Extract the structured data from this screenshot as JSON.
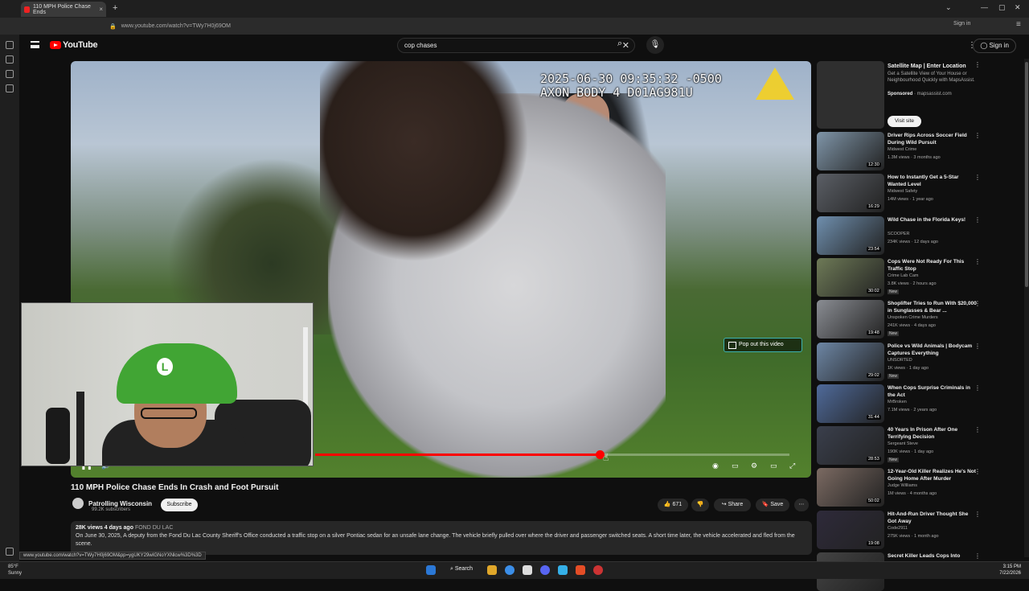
{
  "browser": {
    "tab_title": "110 MPH Police Chase Ends",
    "url": "www.youtube.com/watch?v=TWy7H0j69OM",
    "signin_label": "Sign in",
    "status_url": "www.youtube.com/watch?v=TWy7H0j69OM&pp=ygUKY29wIGNoYXNlcw%3D%3D"
  },
  "youtube": {
    "logo_text": "YouTube",
    "search_value": "cop chases",
    "signin_label": "Sign in"
  },
  "player": {
    "timestamp_line1": "2025-06-30 09:35:32 -0500",
    "timestamp_line2": "AXON BODY 4 D01AG981U",
    "popout_label": "Pop out this video",
    "time_display": "10:59 / 13:20",
    "progress_fraction": 0.6,
    "accent_color": "#ff0000"
  },
  "video": {
    "title": "110 MPH Police Chase Ends In Crash and Foot Pursuit",
    "channel": "Patrolling Wisconsin",
    "subscribers": "99.2K subscribers",
    "subscribe_label": "Subscribe",
    "likes": "671",
    "share_label": "Share",
    "save_label": "Save",
    "views_date": "28K views  4 days ago",
    "location_tag": "FOND DU LAC",
    "description": "On June 30, 2025, A deputy from the Fond Du Lac County Sheriff's Office conducted a traffic stop on a silver Pontiac sedan for an unsafe lane change. The vehicle briefly pulled over where the driver and passenger switched seats. A short time later, the vehicle accelerated and fled from the scene."
  },
  "ad": {
    "title": "Satellite Map | Enter Location",
    "desc": "Get a Satellite View of Your House or Neighbourhood Quickly with MapsAssist.",
    "sponsored": "Sponsored",
    "domain": "· mapsassist.com",
    "visit_label": "Visit site"
  },
  "related": [
    {
      "title": "Driver Rips Across Soccer Field During Wild Pursuit",
      "channel": "Midwest Crime",
      "meta": "1.3M views · 3 months ago",
      "duration": "12:30",
      "new": "",
      "color": "#7f95a8"
    },
    {
      "title": "How to Instantly Get a 5-Star Wanted Level",
      "channel": "Midwest Safety",
      "meta": "14M views · 1 year ago",
      "duration": "16:29",
      "new": "",
      "color": "#5b5f66"
    },
    {
      "title": "Wild Chase in the Florida Keys!",
      "channel": "SCOOPER",
      "meta": "234K views · 12 days ago",
      "duration": "23:54",
      "new": "",
      "color": "#6f8fae"
    },
    {
      "title": "Cops Were Not Ready For This Traffic Stop",
      "channel": "Crime Lab Cam",
      "meta": "3.8K views · 2 hours ago",
      "duration": "30:02",
      "new": "New",
      "color": "#6e7a57"
    },
    {
      "title": "Shoplifter Tries to Run With $20,000 in Sunglasses & Bear ...",
      "channel": "Unspoken Crime Murders",
      "meta": "241K views · 4 days ago",
      "duration": "19:48",
      "new": "New",
      "color": "#8a8d93"
    },
    {
      "title": "Police vs Wild Animals | Bodycam Captures Everything",
      "channel": "UNSORTED",
      "meta": "1K views · 1 day ago",
      "duration": "29:02",
      "new": "New",
      "color": "#6d86a5"
    },
    {
      "title": "When Cops Surprise Criminals in the Act",
      "channel": "MrBroken",
      "meta": "7.1M views · 2 years ago",
      "duration": "31:44",
      "new": "",
      "color": "#4f6a9a"
    },
    {
      "title": "40 Years In Prison After One Terrifying Decision",
      "channel": "Sergeant Steve",
      "meta": "190K views · 1 day ago",
      "duration": "28:53",
      "new": "New",
      "color": "#3a3f4c"
    },
    {
      "title": "12-Year-Old Killer Realizes He's Not Going Home After Murder",
      "channel": "Judge Williams",
      "meta": "1M views · 4 months ago",
      "duration": "50:02",
      "new": "",
      "color": "#7b6a62"
    },
    {
      "title": "Hit-And-Run Driver Thought She Got Away",
      "channel": "Code2911",
      "meta": "275K views · 1 month ago",
      "duration": "19:08",
      "new": "",
      "color": "#2e2a3a"
    },
    {
      "title": "Secret Killer Leads Cops Into",
      "channel": "",
      "meta": "",
      "duration": "",
      "new": "",
      "color": "#444"
    }
  ],
  "taskbar": {
    "weather_temp": "85°F",
    "weather_cond": "Sunny",
    "search_label": "Search",
    "time": "3:15 PM",
    "date": "7/22/2026"
  }
}
